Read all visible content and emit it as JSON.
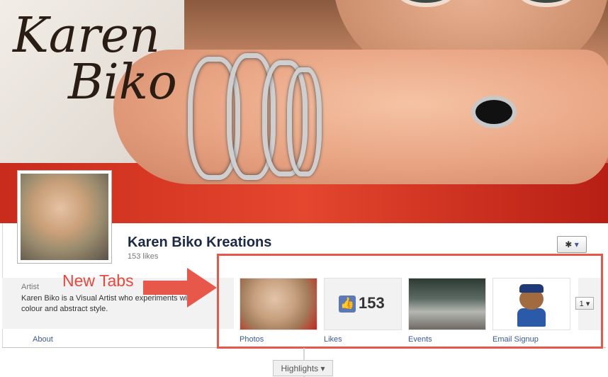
{
  "cover": {
    "title_line1": "Karen",
    "title_line2": "Biko"
  },
  "page": {
    "name": "Karen Biko Kreations",
    "likes": "153 likes"
  },
  "settings": {
    "gear_icon": "gear-icon",
    "caret": "▾"
  },
  "info": {
    "label": "Artist",
    "text": "Karen Biko is a Visual Artist who experiments with colour and abstract style."
  },
  "about_link": "About",
  "annotation": {
    "text": "New Tabs",
    "color": "#e8483c"
  },
  "tabs": [
    {
      "label": "Photos"
    },
    {
      "label": "Likes",
      "value": "153"
    },
    {
      "label": "Events"
    },
    {
      "label": "Email Signup"
    }
  ],
  "more": {
    "label": "1",
    "caret": "▾"
  },
  "highlights": {
    "label": "Highlights",
    "caret": "▾"
  },
  "colors": {
    "link": "#3b5998",
    "name": "#1c2a47",
    "annotation": "#e8584a"
  }
}
